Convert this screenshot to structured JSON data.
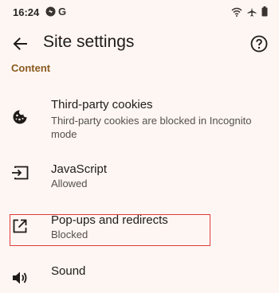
{
  "status_bar": {
    "time": "16:24",
    "left_icons": [
      "notification-icon",
      "google-g-icon"
    ],
    "google_letter": "G",
    "right_icons": [
      "wifi-icon",
      "airplane-icon",
      "battery-icon"
    ]
  },
  "app_bar": {
    "back_icon": "arrow-back-icon",
    "title": "Site settings",
    "help_icon": "help-icon"
  },
  "content": {
    "section_header": "Content",
    "items": [
      {
        "icon": "cookie-icon",
        "title": "Third-party cookies",
        "subtitle": "Third-party cookies are blocked in Incognito mode"
      },
      {
        "icon": "javascript-icon",
        "title": "JavaScript",
        "subtitle": "Allowed"
      },
      {
        "icon": "open-in-new-icon",
        "title": "Pop-ups and redirects",
        "subtitle": "Blocked"
      },
      {
        "icon": "sound-icon",
        "title": "Sound",
        "subtitle": ""
      }
    ]
  },
  "colors": {
    "background": "#fdf6f3",
    "section_header": "#8a5a1f",
    "highlight": "#e03c3c"
  }
}
